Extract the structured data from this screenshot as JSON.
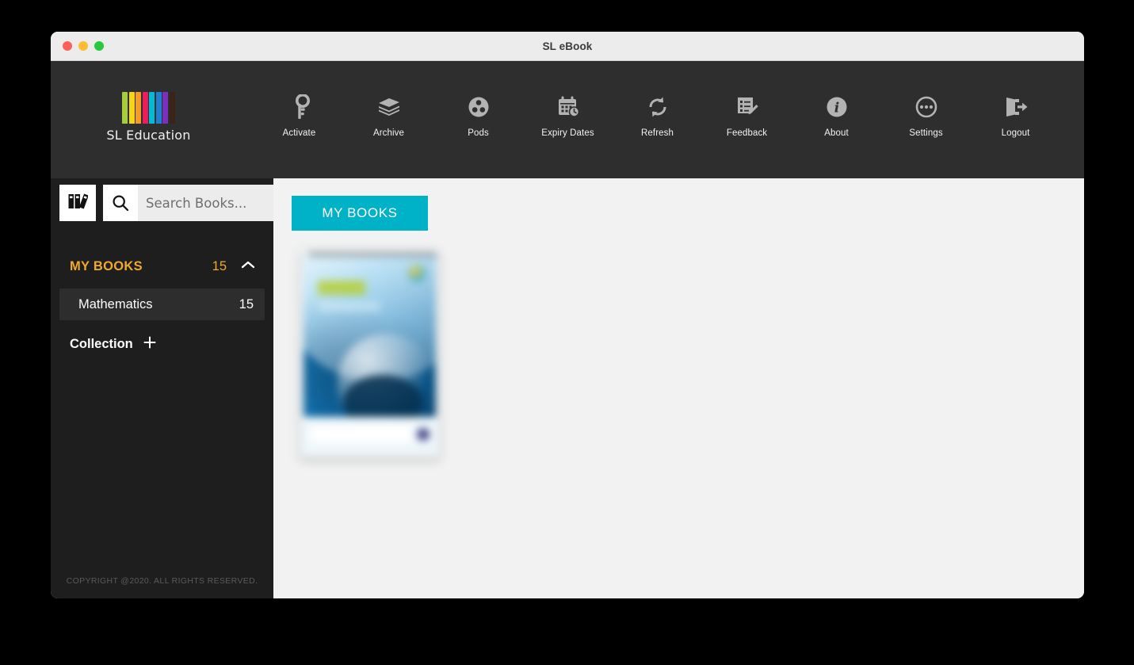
{
  "window": {
    "title": "SL eBook",
    "traffic_lights": [
      "close",
      "minimize",
      "zoom"
    ]
  },
  "brand": {
    "name": "SL Education",
    "spine_colors": [
      "#a6ce39",
      "#f5d514",
      "#f59b28",
      "#ec1d5d",
      "#00bcd4",
      "#1f7fd0",
      "#7b2fbe",
      "#3b2417"
    ]
  },
  "toolbar": {
    "items": [
      {
        "label": "Activate",
        "icon": "key-icon"
      },
      {
        "label": "Archive",
        "icon": "books-stack-icon"
      },
      {
        "label": "Pods",
        "icon": "film-reel-icon"
      },
      {
        "label": "Expiry Dates",
        "icon": "calendar-clock-icon"
      },
      {
        "label": "Refresh",
        "icon": "refresh-icon"
      },
      {
        "label": "Feedback",
        "icon": "form-pencil-icon"
      },
      {
        "label": "About",
        "icon": "info-circle-icon"
      },
      {
        "label": "Settings",
        "icon": "ellipsis-circle-icon"
      },
      {
        "label": "Logout",
        "icon": "logout-door-icon"
      }
    ]
  },
  "sidebar": {
    "library_button_icon": "book-spines-icon",
    "search": {
      "placeholder": "Search Books...",
      "value": "",
      "icon": "search-icon"
    },
    "group": {
      "label": "MY BOOKS",
      "count": "15",
      "expanded": true,
      "chevron_icon": "chevron-up-icon"
    },
    "categories": [
      {
        "label": "Mathematics",
        "count": "15",
        "selected": true
      }
    ],
    "collection": {
      "label": "Collection",
      "add_icon": "plus-icon"
    },
    "copyright": "COPYRIGHT @2020. ALL RIGHTS RESERVED."
  },
  "content": {
    "tab_label": "MY BOOKS",
    "accent_color": "#00b2c8",
    "books": [
      {
        "cover_alt": "blurred blue wave book cover"
      }
    ]
  }
}
